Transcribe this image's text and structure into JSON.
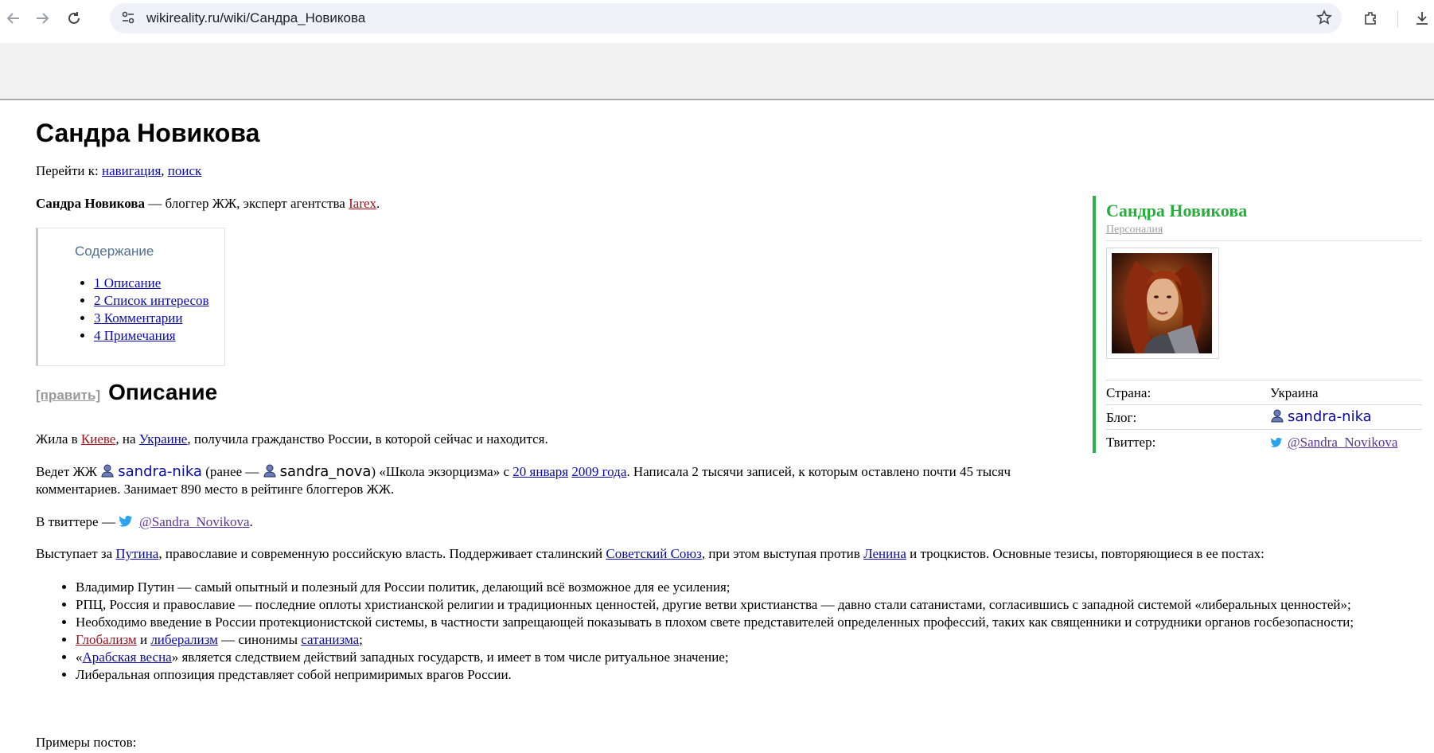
{
  "browser": {
    "url": "wikireality.ru/wiki/Сандра_Новикова",
    "icons": [
      "back-arrow-icon",
      "forward-arrow-icon",
      "reload-icon",
      "site-settings-icon",
      "bookmark-star-icon",
      "extensions-icon",
      "download-icon"
    ]
  },
  "page": {
    "title": "Сандра Новикова",
    "jump": {
      "prefix": "Перейти к: ",
      "nav": "навигация",
      "comma": ", ",
      "search": "поиск"
    },
    "intro": {
      "bold": "Сандра Новикова",
      "text": " — блоггер ЖЖ, эксперт агентства ",
      "link": "Iarex",
      "end": "."
    },
    "toc": {
      "title": "Содержание",
      "items": [
        "1 Описание",
        "2 Список интересов",
        "3 Комментарии",
        "4 Примечания"
      ]
    },
    "section": {
      "edit": "[править]",
      "heading": "Описание"
    },
    "p1": {
      "a": "Жила в ",
      "kiev": "Киеве",
      "b": ", на ",
      "ukraine": "Украине",
      "c": ", получила гражданство России, в которой сейчас и находится."
    },
    "p2": {
      "a": "Ведет ЖЖ ",
      "lj1": "sandra-nika",
      "b": " (ранее — ",
      "lj2": "sandra_nova",
      "c": ") «Школа экзорцизма» с ",
      "date": "20 января",
      "space": " ",
      "year": "2009 года",
      "d": ". Написала 2 тысячи записей, к которым оставлено почти 45 тысяч комментариев. Занимает 890 место в рейтинге блоггеров ЖЖ."
    },
    "p3": {
      "a": "В твиттере — ",
      "twitter": "@Sandra_Novikova",
      "b": "."
    },
    "p4": {
      "a": "Выступает за ",
      "putin": "Путина",
      "b": ", православие и современную российскую власть. Поддерживает сталинский ",
      "ussr": "Советский Союз",
      "c": ", при этом выступая против ",
      "lenin": "Ленина",
      "d": " и троцкистов. Основные тезисы, повторяющиеся в ее постах:"
    },
    "theses": {
      "t1": "Владимир Путин — самый опытный и полезный для России политик, делающий всё возможное для ее усиления;",
      "t2": "РПЦ, Россия и православие — последние оплоты христианской религии и традиционных ценностей, другие ветви христианства — давно стали сатанистами, согласившись с западной системой «либеральных ценностей»;",
      "t3": "Необходимо введение в России протекционистской системы, в частности запрещающей показывать в плохом свете представителей определенных профессий, таких как священники и сотрудники органов госбезопасности;",
      "t4_globalism": "Глобализм",
      "t4_and": " и ",
      "t4_liberalism": "либерализм",
      "t4_mid": " — синонимы ",
      "t4_satanism": "сатанизма",
      "t4_end": ";",
      "t5_open": "«",
      "t5_link": "Арабская весна",
      "t5_rest": "» является следствием действий западных государств, и имеет в том числе ритуальное значение;",
      "t6": "Либеральная оппозиция представляет собой непримиримых врагов России."
    },
    "p5": "Примеры постов:"
  },
  "infobox": {
    "title": "Сандра Новикова",
    "subtitle": "Персоналия",
    "rows": [
      {
        "key": "Страна:",
        "value": "Украина"
      },
      {
        "key": "Блог:",
        "value": "sandra-nika"
      },
      {
        "key": "Твиттер:",
        "value": "@Sandra_Novikova"
      }
    ]
  },
  "colors": {
    "link": "#0b0bac",
    "redlink": "#a3101a",
    "visited": "#5a3696",
    "infobox_accent": "#2ab34a"
  }
}
